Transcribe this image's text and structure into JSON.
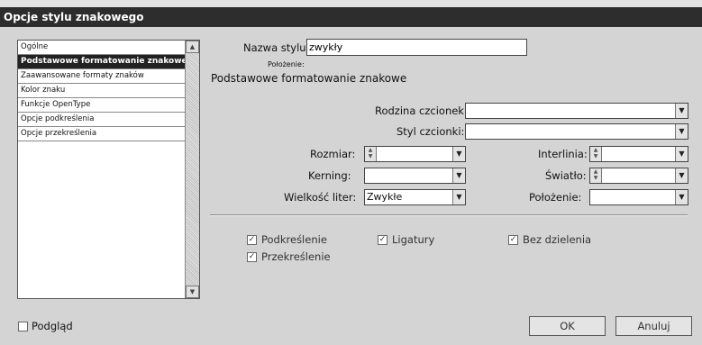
{
  "window": {
    "title": "Opcje stylu znakowego"
  },
  "sidebar": {
    "items": [
      {
        "label": "Ogólne",
        "selected": false
      },
      {
        "label": "Podstawowe formatowanie znakowe",
        "selected": true
      },
      {
        "label": "Zaawansowane formaty znaków",
        "selected": false
      },
      {
        "label": "Kolor znaku",
        "selected": false
      },
      {
        "label": "Funkcje OpenType",
        "selected": false
      },
      {
        "label": "Opcje podkreślenia",
        "selected": false
      },
      {
        "label": "Opcje przekreślenia",
        "selected": false
      }
    ]
  },
  "form": {
    "style_name_label": "Nazwa stylu:",
    "style_name_value": "zwykły",
    "position_label": "Położenie:",
    "section_title": "Podstawowe formatowanie znakowe",
    "font_family": {
      "label": "Rodzina czcionek:",
      "value": ""
    },
    "font_style": {
      "label": "Styl czcionki:",
      "value": ""
    },
    "size": {
      "label": "Rozmiar:",
      "value": ""
    },
    "leading": {
      "label": "Interlinia:",
      "value": ""
    },
    "kerning": {
      "label": "Kerning:",
      "value": ""
    },
    "tracking": {
      "label": "Światło:",
      "value": ""
    },
    "case": {
      "label": "Wielkość liter:",
      "value": "Zwykłe"
    },
    "position": {
      "label": "Położenie:",
      "value": ""
    }
  },
  "checkboxes": [
    {
      "label": "Podkreślenie",
      "checked": true
    },
    {
      "label": "Ligatury",
      "checked": true
    },
    {
      "label": "Bez dzielenia",
      "checked": true
    },
    {
      "label": "Przekreślenie",
      "checked": true
    }
  ],
  "footer": {
    "preview_label": "Podgląd",
    "preview_checked": false,
    "ok_label": "OK",
    "cancel_label": "Anuluj"
  }
}
